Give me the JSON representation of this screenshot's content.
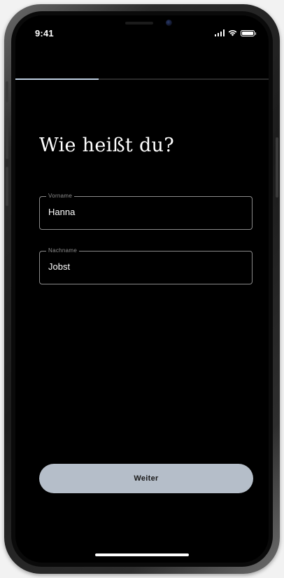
{
  "status_bar": {
    "time": "9:41",
    "icons": [
      "signal-icon",
      "wifi-icon",
      "battery-icon"
    ],
    "battery_level": 1.0
  },
  "progress": {
    "fraction": 0.33,
    "fill_color": "#bfd0e2"
  },
  "page_title": "Wie heißt du?",
  "form": {
    "first_name": {
      "label": "Vorname",
      "value": "Hanna"
    },
    "last_name": {
      "label": "Nachname",
      "value": "Jobst"
    }
  },
  "continue_button": {
    "label": "Weiter",
    "color": "#b5bec9"
  },
  "colors": {
    "screen_background": "#000000",
    "text": "#ffffff",
    "field_border": "#8a8a8a",
    "label": "#8d8d8d"
  }
}
